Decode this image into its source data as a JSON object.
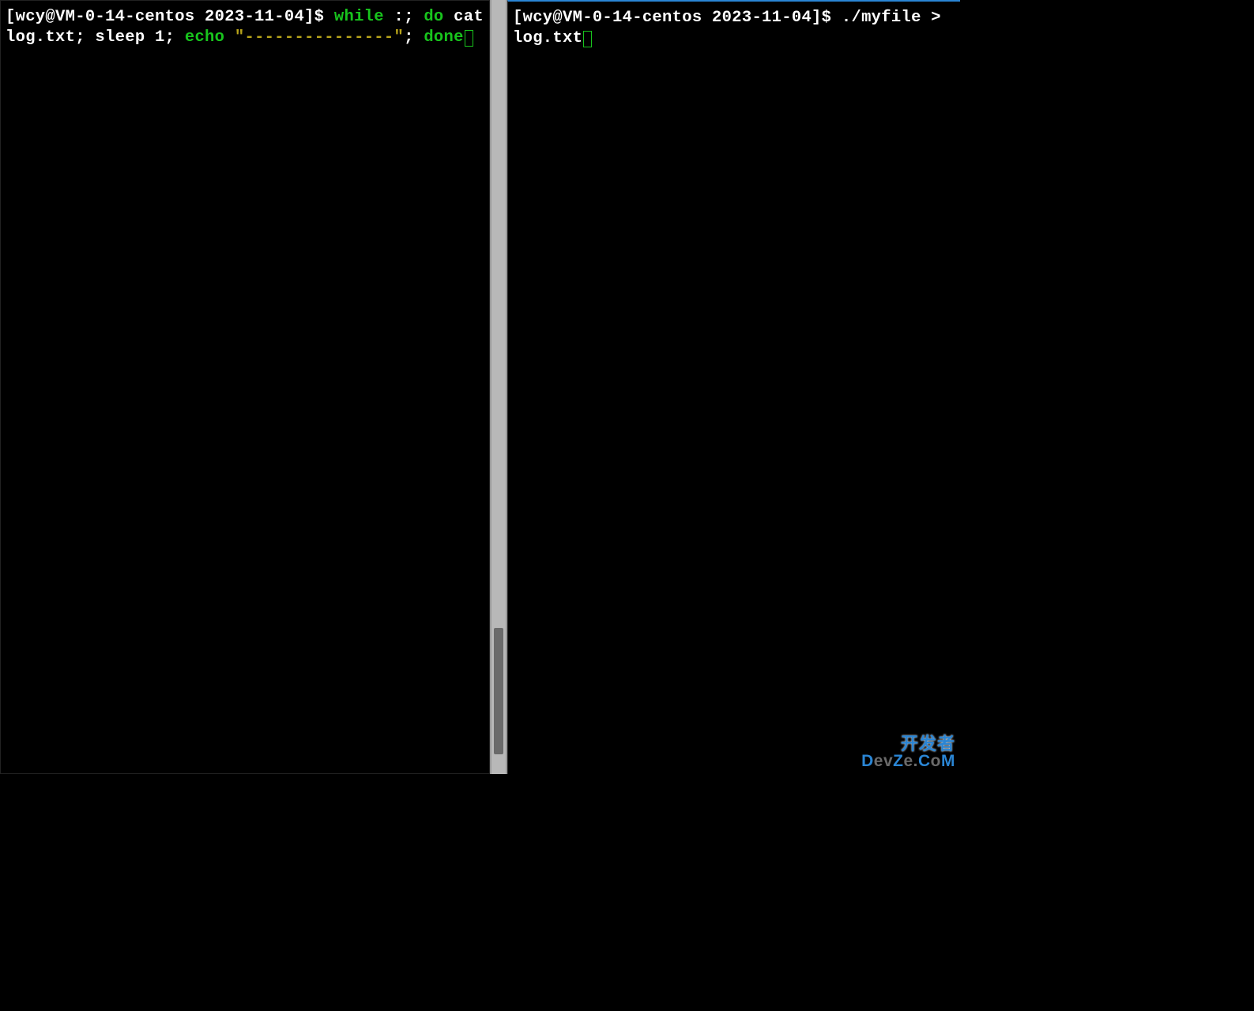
{
  "left_pane": {
    "prompt": "[wcy@VM-0-14-centos 2023-11-04]$ ",
    "kw_while": "while",
    "text1": " :; ",
    "kw_do": "do",
    "text2": " cat log.txt; sleep 1; ",
    "kw_echo": "echo",
    "text3": " ",
    "str_dashes": "\"---------------\"",
    "text4": "; ",
    "kw_done": "done"
  },
  "right_pane": {
    "prompt": "[wcy@VM-0-14-centos 2023-11-04]$ ",
    "command": "./myfile > log.txt"
  },
  "watermark": {
    "line1": "开发者",
    "line2_parts": [
      "D",
      "ev",
      "Z",
      "e",
      ".",
      "C",
      "o",
      "M"
    ]
  }
}
